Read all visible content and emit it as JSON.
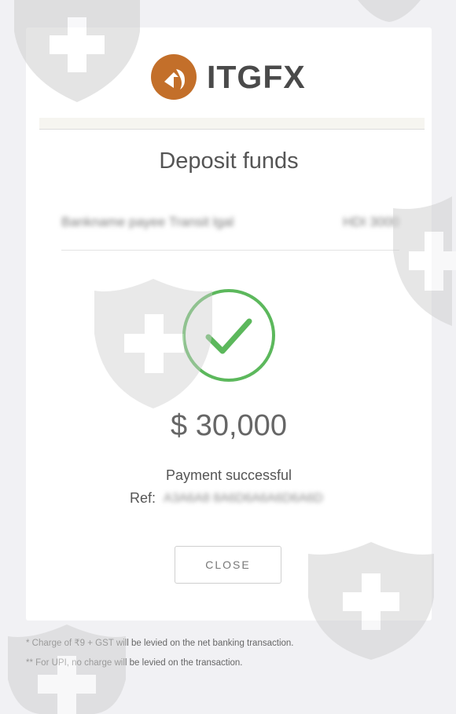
{
  "brand": {
    "name_main": "ITGF",
    "name_x": "X",
    "logo_icon": "itgfx-logo-icon",
    "accent": "#c36f2a"
  },
  "page": {
    "title": "Deposit funds"
  },
  "account": {
    "left_text": "Bankname payee Transit lgal",
    "right_text": "HDI 3000"
  },
  "result": {
    "icon": "check-circle-icon",
    "success_color": "#5cb85c",
    "amount": "$ 30,000",
    "status": "Payment successful",
    "ref_label": "Ref:",
    "ref_value": "A3A6A8 8A6D6A6A6D6A6D"
  },
  "actions": {
    "close_label": "CLOSE"
  },
  "notes": {
    "line1": "* Charge of ₹9 + GST will be levied on the net banking transaction.",
    "line2": "** For UPI, no charge will be levied on the transaction."
  },
  "watermark": {
    "icon": "shield-plus-icon",
    "color": "#d9d9d9"
  }
}
